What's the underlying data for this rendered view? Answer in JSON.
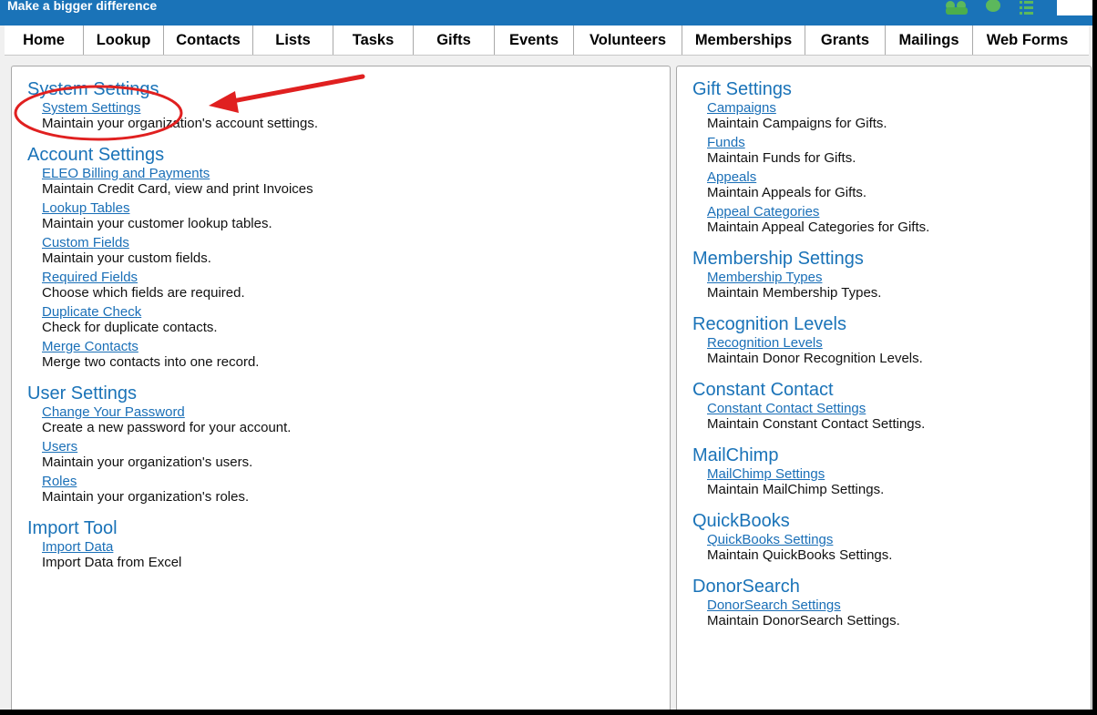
{
  "header": {
    "tagline": "Make a bigger difference"
  },
  "top_icons": [
    "group-icon",
    "leaf-icon",
    "list-icon"
  ],
  "nav": [
    "Home",
    "Lookup",
    "Contacts",
    "Lists",
    "Tasks",
    "Gifts",
    "Events",
    "Volunteers",
    "Memberships",
    "Grants",
    "Mailings",
    "Web Forms"
  ],
  "left_sections": [
    {
      "title": "System Settings",
      "items": [
        {
          "link": "System Settings",
          "desc": "Maintain your organization's account settings."
        }
      ]
    },
    {
      "title": "Account Settings",
      "items": [
        {
          "link": "ELEO Billing and Payments",
          "desc": "Maintain Credit Card, view and print Invoices"
        },
        {
          "link": "Lookup Tables",
          "desc": "Maintain your customer lookup tables."
        },
        {
          "link": "Custom Fields",
          "desc": "Maintain your custom fields."
        },
        {
          "link": "Required Fields",
          "desc": "Choose which fields are required."
        },
        {
          "link": "Duplicate Check",
          "desc": "Check for duplicate contacts."
        },
        {
          "link": "Merge Contacts",
          "desc": "Merge two contacts into one record."
        }
      ]
    },
    {
      "title": "User Settings",
      "items": [
        {
          "link": "Change Your Password",
          "desc": "Create a new password for your account."
        },
        {
          "link": "Users",
          "desc": "Maintain your organization's users."
        },
        {
          "link": "Roles",
          "desc": "Maintain your organization's roles."
        }
      ]
    },
    {
      "title": "Import Tool",
      "items": [
        {
          "link": "Import Data",
          "desc": "Import Data from Excel"
        }
      ]
    }
  ],
  "right_sections": [
    {
      "title": "Gift Settings",
      "items": [
        {
          "link": "Campaigns",
          "desc": "Maintain Campaigns for Gifts."
        },
        {
          "link": "Funds",
          "desc": "Maintain Funds for Gifts."
        },
        {
          "link": "Appeals",
          "desc": "Maintain Appeals for Gifts."
        },
        {
          "link": "Appeal Categories",
          "desc": "Maintain Appeal Categories for Gifts."
        }
      ]
    },
    {
      "title": "Membership Settings",
      "items": [
        {
          "link": "Membership Types",
          "desc": "Maintain Membership Types."
        }
      ]
    },
    {
      "title": "Recognition Levels",
      "items": [
        {
          "link": "Recognition Levels",
          "desc": "Maintain Donor Recognition Levels."
        }
      ]
    },
    {
      "title": "Constant Contact",
      "items": [
        {
          "link": "Constant Contact Settings",
          "desc": "Maintain Constant Contact Settings."
        }
      ]
    },
    {
      "title": "MailChimp",
      "items": [
        {
          "link": "MailChimp Settings",
          "desc": "Maintain MailChimp Settings."
        }
      ]
    },
    {
      "title": "QuickBooks",
      "items": [
        {
          "link": "QuickBooks Settings",
          "desc": "Maintain QuickBooks Settings."
        }
      ]
    },
    {
      "title": "DonorSearch",
      "items": [
        {
          "link": "DonorSearch Settings",
          "desc": "Maintain DonorSearch Settings."
        }
      ]
    }
  ],
  "colors": {
    "accent": "#1a73b8",
    "link": "#1a6fb7",
    "annotation": "#e02020"
  }
}
